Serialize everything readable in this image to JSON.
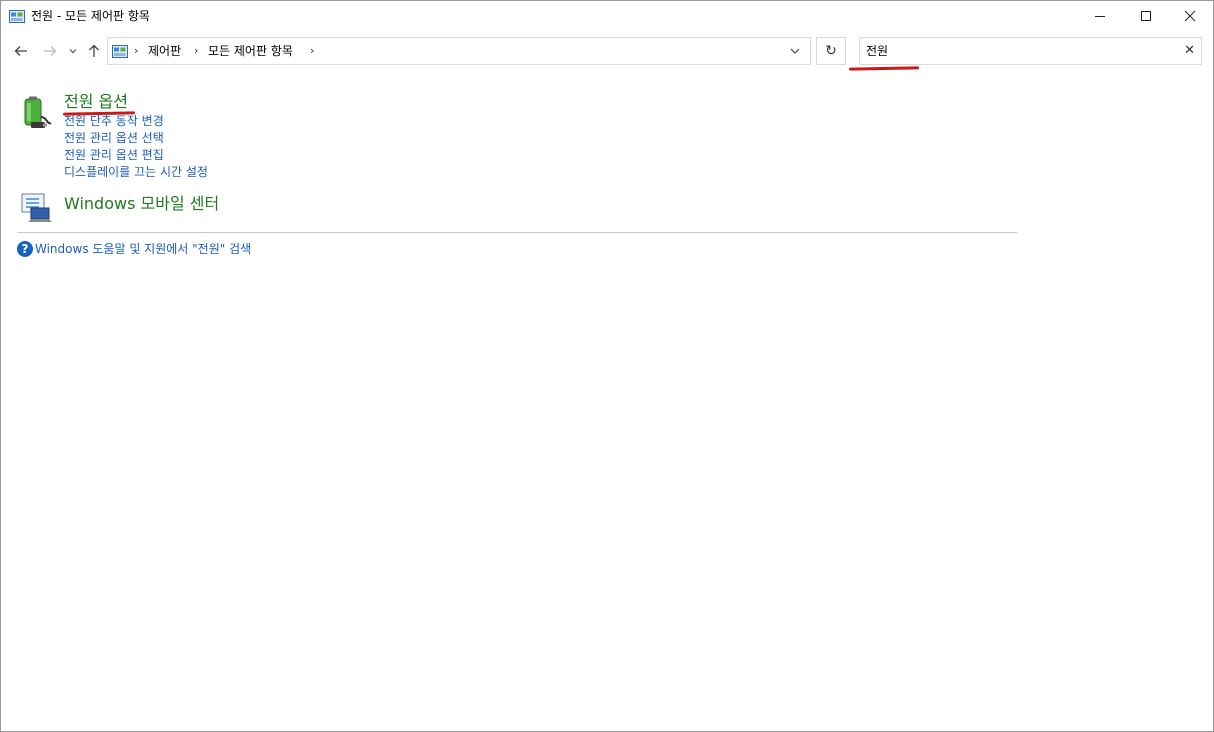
{
  "window": {
    "title": "전원 - 모든 제어판 항목"
  },
  "address": {
    "crumbs": [
      "제어판",
      "모든 제어판 항목"
    ]
  },
  "search": {
    "value": "전원",
    "clear_glyph": "✕"
  },
  "refresh_glyph": "↻",
  "results": [
    {
      "title": "전원 옵션",
      "links": [
        "전원 단추 동작 변경",
        "전원 관리 옵션 선택",
        "전원 관리 옵션 편집",
        "디스플레이를 끄는 시간 설정"
      ]
    },
    {
      "title": "Windows 모바일 센터",
      "links": []
    }
  ],
  "help": {
    "icon_glyph": "?",
    "link": "Windows 도움말 및 지원에서 \"전원\" 검색"
  },
  "colors": {
    "title_green": "#1e7b1e",
    "link_blue": "#1a5cbf",
    "annotation_red": "#c81b1b"
  }
}
